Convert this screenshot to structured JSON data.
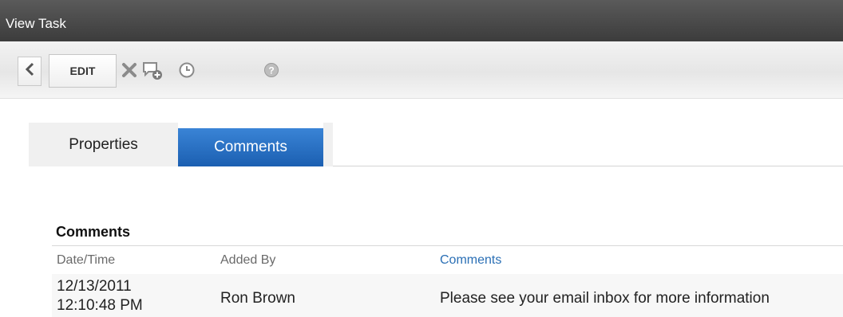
{
  "window": {
    "title": "View Task"
  },
  "toolbar": {
    "back_icon": "chevron-left-icon",
    "edit_label": "EDIT",
    "delete_icon": "close-icon",
    "comment_icon": "add-comment-icon",
    "timer_icon": "clock-icon",
    "help_icon": "help-icon"
  },
  "tabs": [
    {
      "label": "Properties",
      "active": false
    },
    {
      "label": "Comments",
      "active": true
    }
  ],
  "comments": {
    "title": "Comments",
    "columns": [
      "Date/Time",
      "Added By",
      "Comments"
    ],
    "rows": [
      {
        "date": "12/13/2011",
        "time": "12:10:48 PM",
        "added_by": "Ron Brown",
        "comment": "Please see your email inbox for more information"
      }
    ]
  },
  "colors": {
    "titlebar": "#3c3c3c",
    "active_tab": "#1b5fb1",
    "link_header": "#2a6fb5"
  }
}
